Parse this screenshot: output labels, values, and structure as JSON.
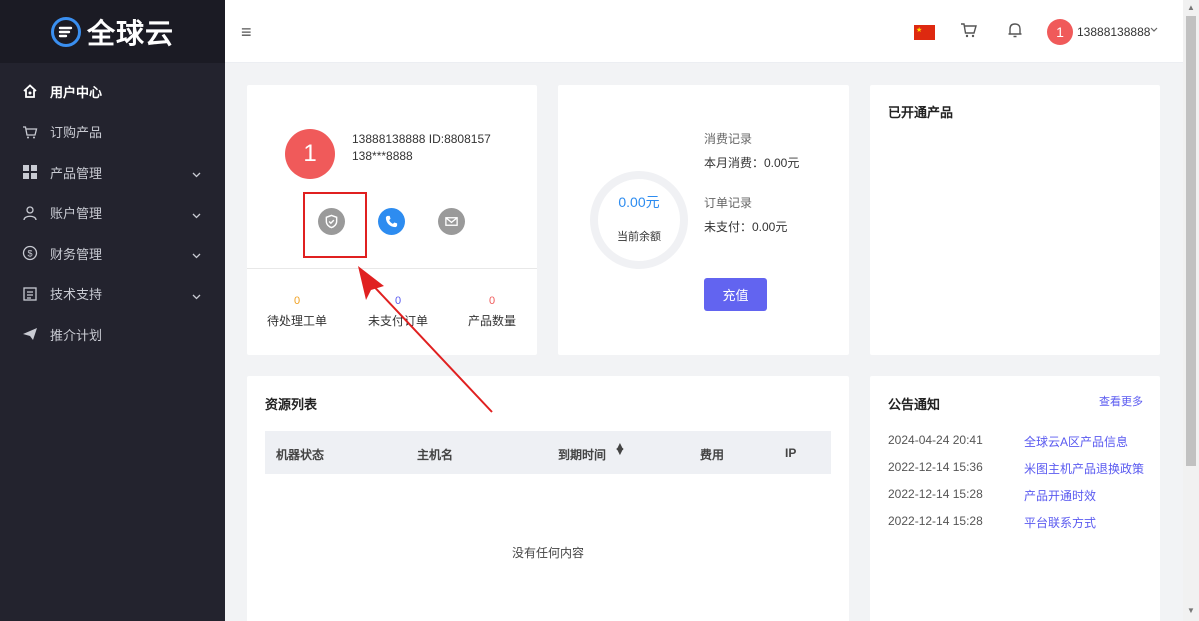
{
  "brand": {
    "logo_text": "全球云"
  },
  "sidebar": {
    "items": [
      {
        "label": "用户中心",
        "icon": "home-icon",
        "active": true,
        "has_children": false
      },
      {
        "label": "订购产品",
        "icon": "cart-icon",
        "active": false,
        "has_children": false
      },
      {
        "label": "产品管理",
        "icon": "grid-icon",
        "active": false,
        "has_children": true
      },
      {
        "label": "账户管理",
        "icon": "user-icon",
        "active": false,
        "has_children": true
      },
      {
        "label": "财务管理",
        "icon": "dollar-icon",
        "active": false,
        "has_children": true
      },
      {
        "label": "技术支持",
        "icon": "document-icon",
        "active": false,
        "has_children": true
      },
      {
        "label": "推介计划",
        "icon": "send-icon",
        "active": false,
        "has_children": false
      }
    ]
  },
  "header": {
    "user_avatar_text": "1",
    "user_name": "13888138888"
  },
  "profile": {
    "avatar_text": "1",
    "line1": "13888138888 ID:8808157",
    "line2": "138***8888",
    "stats": [
      {
        "value": "0",
        "label": "待处理工单"
      },
      {
        "value": "0",
        "label": "未支付订单"
      },
      {
        "value": "0",
        "label": "产品数量"
      }
    ]
  },
  "balance": {
    "amount": "0.00元",
    "amount_label": "当前余额",
    "consumption_title": "消费记录",
    "consumption_value": "本月消费：0.00元",
    "order_title": "订单记录",
    "order_value": "未支付：0.00元",
    "recharge_label": "充值"
  },
  "opened_products": {
    "title": "已开通产品"
  },
  "resources": {
    "title": "资源列表",
    "columns": [
      "机器状态",
      "主机名",
      "到期时间",
      "费用",
      "IP"
    ],
    "empty_text": "没有任何内容"
  },
  "notices": {
    "title": "公告通知",
    "more_label": "查看更多",
    "items": [
      {
        "date": "2024-04-24 20:41",
        "title": "全球云A区产品信息"
      },
      {
        "date": "2022-12-14 15:36",
        "title": "米图主机产品退换政策"
      },
      {
        "date": "2022-12-14 15:28",
        "title": "产品开通时效"
      },
      {
        "date": "2022-12-14 15:28",
        "title": "平台联系方式"
      }
    ]
  },
  "colors": {
    "sidebar_bg": "#23232e",
    "accent": "#6264f0",
    "avatar": "#f05a5a",
    "annotation": "#e02020"
  }
}
